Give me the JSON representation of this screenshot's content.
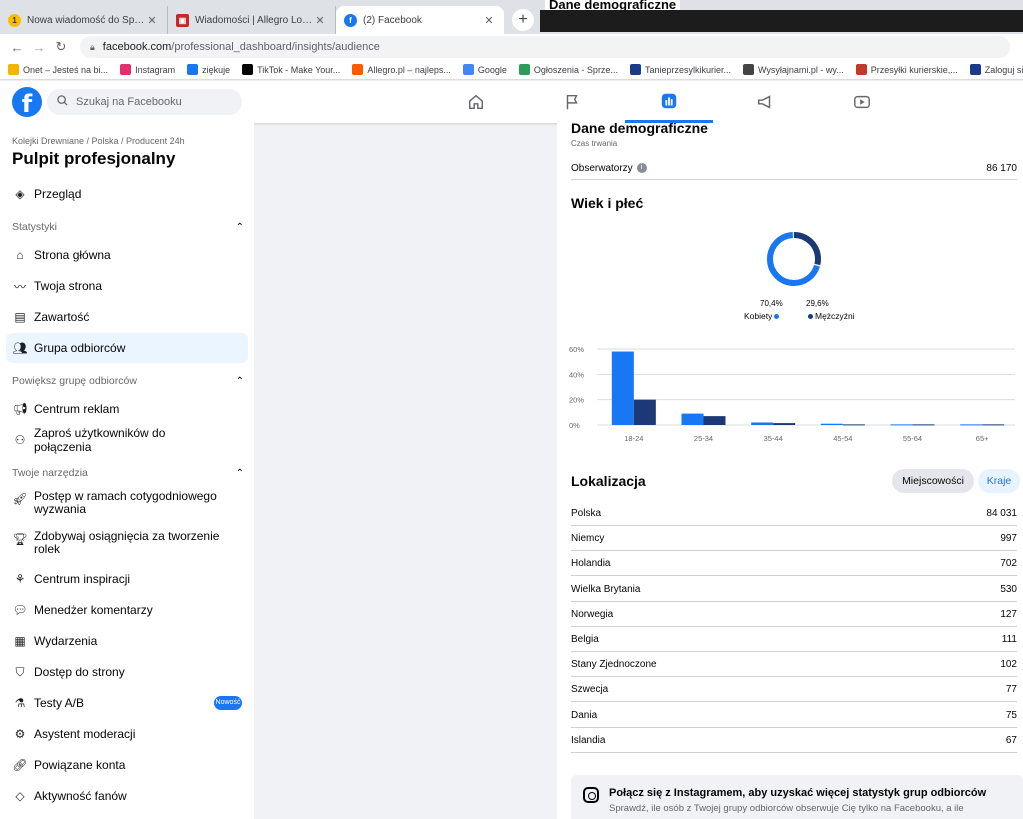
{
  "browser": {
    "tabs": [
      {
        "label": "Nowa wiadomość do Sprzedam",
        "icon": "notification-favicon",
        "color": "#fbbc04",
        "active": false
      },
      {
        "label": "Wiadomości | Allegro Lokalnie",
        "icon": "allegro-favicon",
        "color": "#ff5a00",
        "active": false
      },
      {
        "label": "(2) Facebook",
        "icon": "facebook-favicon",
        "color": "#1877f2",
        "active": true
      }
    ],
    "url_host": "facebook.com",
    "url_path": "/professional_dashboard/insights/audience",
    "overlay_text": "Dane demograficzne",
    "bookmarks": [
      {
        "label": "Onet – Jesteś na bi...",
        "color": "#f4b400"
      },
      {
        "label": "Instagram",
        "color": "#e1306c"
      },
      {
        "label": "ziękuje",
        "color": "#1877f2"
      },
      {
        "label": "TikTok - Make Your...",
        "color": "#000000"
      },
      {
        "label": "Allegro.pl – najleps...",
        "color": "#ff5a00"
      },
      {
        "label": "Google",
        "color": "#4285f4"
      },
      {
        "label": "Ogłoszenia - Sprze...",
        "color": "#2b9c5a"
      },
      {
        "label": "Tanieprzesylkikurier...",
        "color": "#1b3a8a"
      },
      {
        "label": "Wysyłajnami.pl - wy...",
        "color": "#444444"
      },
      {
        "label": "Przesyłki kurierskie,...",
        "color": "#c0392b"
      },
      {
        "label": "Zaloguj się",
        "color": "#1b3a8a"
      },
      {
        "label": "Prz",
        "color": "#444444"
      }
    ]
  },
  "fb": {
    "search_placeholder": "Szukaj na Facebooku",
    "nav_icons": [
      "home-icon",
      "flag-icon",
      "insights-icon",
      "megaphone-icon",
      "video-icon"
    ]
  },
  "sidebar": {
    "breadcrumb": "Kolejki Drewniane / Polska / Producent 24h",
    "title": "Pulpit profesjonalny",
    "overview": "Przegląd",
    "section_stats": "Statystyki",
    "stats_items": [
      "Strona główna",
      "Twoja strona",
      "Zawartość",
      "Grupa odbiorców"
    ],
    "section_grow": "Powiększ grupę odbiorców",
    "grow_items": [
      "Centrum reklam",
      "Zaproś użytkowników do połączenia"
    ],
    "section_tools": "Twoje narzędzia",
    "tools_items": [
      "Postęp w ramach cotygodniowego wyzwania",
      "Zdobywaj osiągnięcia za tworzenie rolek",
      "Centrum inspiracji",
      "Menedżer komentarzy",
      "Wydarzenia",
      "Dostęp do strony",
      "Testy A/B",
      "Asystent moderacji",
      "Powiązane konta",
      "Aktywność fanów"
    ],
    "badge": "Nowość"
  },
  "main": {
    "demo_title": "Dane demograficzne",
    "duration_label": "Czas trwania",
    "viewers_label": "Obserwatorzy",
    "viewers_value": "86 170",
    "age_title": "Wiek i płeć",
    "women_pct": "70,4%",
    "men_pct": "29,6%",
    "women_label": "Kobiety",
    "men_label": "Mężczyźni",
    "colors": {
      "women": "#1877f2",
      "men": "#1b3a75"
    },
    "location_title": "Lokalizacja",
    "btn_cities": "Miejscowości",
    "btn_countries": "Kraje",
    "locations": [
      {
        "name": "Polska",
        "value": "84 031"
      },
      {
        "name": "Niemcy",
        "value": "997"
      },
      {
        "name": "Holandia",
        "value": "702"
      },
      {
        "name": "Wielka Brytania",
        "value": "530"
      },
      {
        "name": "Norwegia",
        "value": "127"
      },
      {
        "name": "Belgia",
        "value": "111"
      },
      {
        "name": "Stany Zjednoczone",
        "value": "102"
      },
      {
        "name": "Szwecja",
        "value": "77"
      },
      {
        "name": "Dania",
        "value": "75"
      },
      {
        "name": "Islandia",
        "value": "67"
      }
    ],
    "ig_title": "Połącz się z Instagramem, aby uzyskać więcej statystyk grup odbiorców",
    "ig_sub": "Sprawdź, ile osób z Twojej grupy odbiorców obserwuje Cię tylko na Facebooku, a ile"
  },
  "chart_data": {
    "type": "bar",
    "categories": [
      "18-24",
      "25-34",
      "35-44",
      "45-54",
      "55-64",
      "65+"
    ],
    "series": [
      {
        "name": "Kobiety",
        "values": [
          58,
          9,
          2,
          1,
          0.5,
          0.5
        ]
      },
      {
        "name": "Mężczyźni",
        "values": [
          20,
          7,
          1.5,
          0.5,
          0.5,
          0.5
        ]
      }
    ],
    "yticks": [
      "60%",
      "40%",
      "20%",
      "0%"
    ],
    "ylim": [
      0,
      60
    ],
    "grid": true,
    "donut": {
      "values": [
        70.4,
        29.6
      ]
    }
  }
}
